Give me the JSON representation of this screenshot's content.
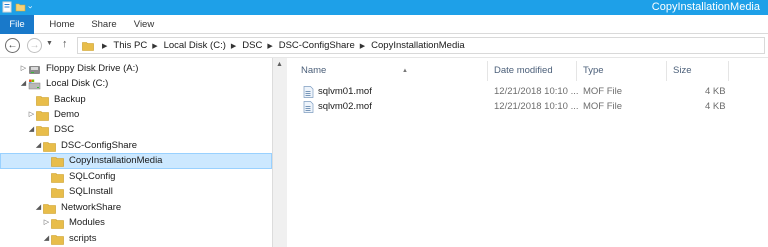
{
  "window": {
    "title": "CopyInstallationMedia"
  },
  "ribbon": {
    "tabs": [
      "File",
      "Home",
      "Share",
      "View"
    ]
  },
  "address": {
    "crumbs": [
      "This PC",
      "Local Disk (C:)",
      "DSC",
      "DSC-ConfigShare",
      "CopyInstallationMedia"
    ]
  },
  "tree": [
    {
      "label": "Floppy Disk Drive (A:)",
      "icon": "floppy-drive-icon",
      "expanded": false
    },
    {
      "label": "Local Disk (C:)",
      "icon": "local-disk-icon",
      "expanded": true
    },
    {
      "label": "Backup",
      "icon": "folder-icon"
    },
    {
      "label": "Demo",
      "icon": "folder-icon",
      "expanded": false
    },
    {
      "label": "DSC",
      "icon": "folder-icon",
      "expanded": true
    },
    {
      "label": "DSC-ConfigShare",
      "icon": "folder-icon",
      "expanded": true
    },
    {
      "label": "CopyInstallationMedia",
      "icon": "folder-icon",
      "selected": true
    },
    {
      "label": "SQLConfig",
      "icon": "folder-icon"
    },
    {
      "label": "SQLInstall",
      "icon": "folder-icon"
    },
    {
      "label": "NetworkShare",
      "icon": "folder-icon",
      "expanded": true
    },
    {
      "label": "Modules",
      "icon": "folder-icon",
      "expanded": false
    },
    {
      "label": "scripts",
      "icon": "folder-icon",
      "expanded": true
    }
  ],
  "columns": {
    "name": "Name",
    "date": "Date modified",
    "type": "Type",
    "size": "Size"
  },
  "files": [
    {
      "name": "sqlvm01.mof",
      "date": "12/21/2018 10:10 ...",
      "type": "MOF File",
      "size": "4 KB"
    },
    {
      "name": "sqlvm02.mof",
      "date": "12/21/2018 10:10 ...",
      "type": "MOF File",
      "size": "4 KB"
    }
  ],
  "colors": {
    "titlebar": "#1ea0e8",
    "file_tab": "#1979ca",
    "selection": "#cce8ff",
    "folder": "#e8bd4a"
  }
}
